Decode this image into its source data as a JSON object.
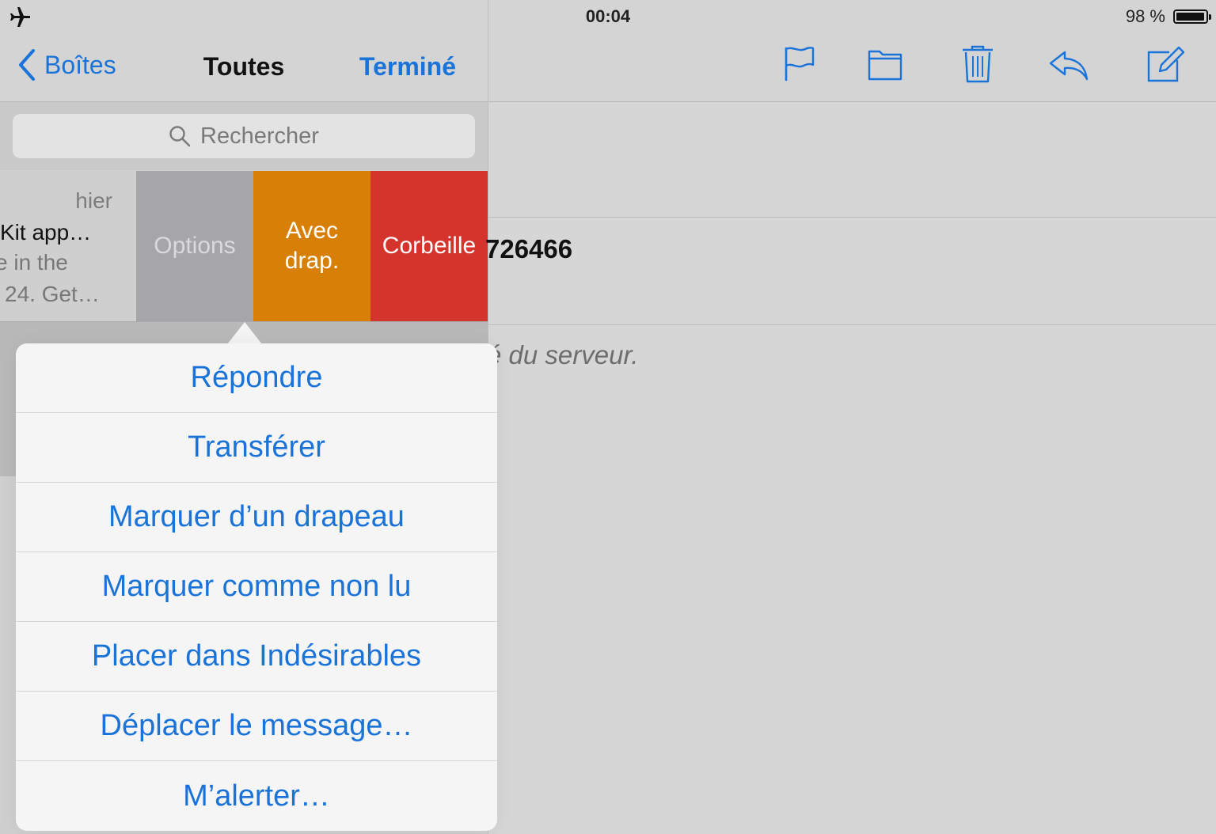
{
  "status": {
    "time": "00:04",
    "battery": "98 %",
    "battery_level": 0.98,
    "airplane_icon": "airplane-icon"
  },
  "nav": {
    "back_label": "Boîtes",
    "title": "Toutes",
    "done_label": "Terminé"
  },
  "search": {
    "placeholder": "Rechercher"
  },
  "mail_row": {
    "date": "hier",
    "subject": "Kit app…",
    "preview_line1": "e in the",
    "preview_line2": "24. Get…"
  },
  "swipe_actions": {
    "options": "Options",
    "flag_line1": "Avec",
    "flag_line2": "drap.",
    "trash": "Corbeille"
  },
  "toolbar": {
    "icons": [
      "flag-icon",
      "folder-icon",
      "trash-icon",
      "reply-icon",
      "compose-icon"
    ]
  },
  "message": {
    "number_fragment": "726466",
    "server_fragment": "é du serveur."
  },
  "popover": {
    "items": [
      "Répondre",
      "Transférer",
      "Marquer d’un drapeau",
      "Marquer comme non lu",
      "Placer dans Indésirables",
      "Déplacer le message…",
      "M’alerter…"
    ]
  },
  "colors": {
    "accent": "#1a73d9",
    "flag_action": "#d77f07",
    "trash_action": "#d4342b",
    "options_action": "#a6a6a9"
  }
}
